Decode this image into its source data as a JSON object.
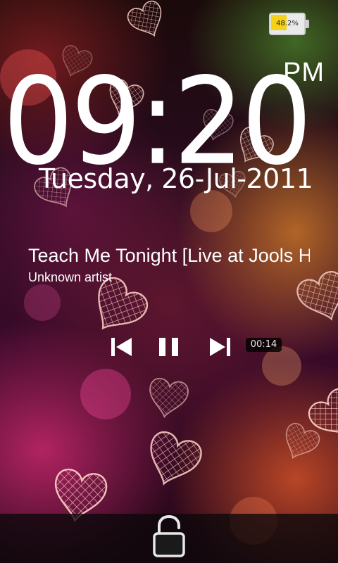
{
  "status_bar": {
    "battery_label": "48.2%",
    "battery_level": 0.482,
    "battery_icon": "battery-icon",
    "battery_fill_color": "#f4d21a"
  },
  "clock": {
    "time": "09:20",
    "ampm": "PM",
    "date": "Tuesday, 26-Jul-2011"
  },
  "music": {
    "title": "Teach Me Tonight [Live at Jools Holland]",
    "artist": "Unknown artist",
    "elapsed": "00:14",
    "controls": [
      {
        "name": "previous",
        "icon": "skip-previous-icon"
      },
      {
        "name": "pause",
        "icon": "pause-icon"
      },
      {
        "name": "next",
        "icon": "skip-next-icon"
      }
    ]
  },
  "lock": {
    "icon": "unlock-icon"
  },
  "wallpaper": {
    "theme": "bokeh-hearts",
    "accent_colors": [
      "#e03a7a",
      "#f07a40",
      "#c83a3a",
      "#6a9a30"
    ]
  }
}
